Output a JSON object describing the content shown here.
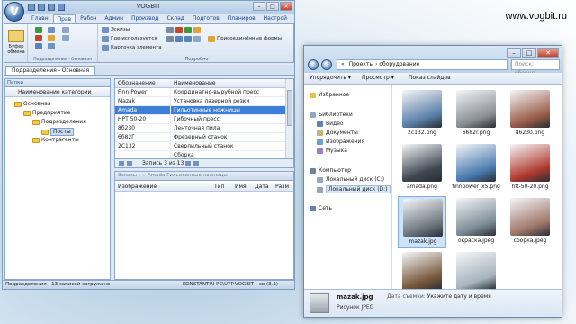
{
  "website": "www.vogbit.ru",
  "app": {
    "title": "VOGBIT",
    "tabs": [
      "Главн",
      "Прав",
      "Рабоч",
      "Админ",
      "Производ",
      "Склад",
      "Подготов",
      "Планиров",
      "Настрой"
    ],
    "active_tab": "Прав",
    "ribbon": {
      "buffer_label": "Буфер обмена",
      "group1_label": "Подразделения - Основная",
      "items": [
        "Эскизы",
        "Где используется",
        "Карточка элемента"
      ],
      "right_item": "Присоединённые формы",
      "group2_label": "Подробно"
    },
    "doc_tab": "Подразделения - Основная",
    "tree": {
      "panel_title": "Папки",
      "column": "Наименование категории",
      "items": [
        "Основная",
        "Предприятие",
        "Подразделения",
        "Посты",
        "Контрагенты"
      ]
    },
    "grid": {
      "columns": [
        "Обозначение",
        "Наименование"
      ],
      "rows": [
        [
          "Finn Power",
          "Координатно-вырубной пресс"
        ],
        [
          "Mazak",
          "Установка лазерной резки"
        ],
        [
          "Amada",
          "Гильотинные ножницы"
        ],
        [
          "HPT 50-20",
          "Гибочный пресс"
        ],
        [
          "8б230",
          "Ленточная пила"
        ],
        [
          "6б82Г",
          "Фрезерный станок"
        ],
        [
          "2С132",
          "Сверлильный станок"
        ],
        [
          "",
          "Сборка"
        ]
      ],
      "selected_row": 2,
      "record_status": "Запись 3 из 13"
    },
    "detail": {
      "header": "Эскизы » » Amada Гильотинные ножницы",
      "columns": [
        "Изображение",
        "Тип",
        "Имя",
        "Дата",
        "Разм"
      ]
    },
    "status": {
      "left": "Подразделения - 13 записей загружено",
      "user": "KONSTANTIN-PC\\UTP",
      "db": "VOGBIT",
      "ver": "эв (3.1)"
    }
  },
  "explorer": {
    "address": "« _Проекты › оборудование",
    "search_placeholder": "Поиск: оборуд...",
    "toolbar": [
      "Упорядочить ▾",
      "Просмотр ▾",
      "Показ слайдов"
    ],
    "nav": {
      "favorites": "Избранное",
      "libraries": "Библиотеки",
      "library_items": [
        "Видео",
        "Документы",
        "Изображения",
        "Музыка"
      ],
      "computer": "Компьютер",
      "drives": [
        "Локальный диск (C:)",
        "Локальный диск (D:)"
      ],
      "network": "Сеть"
    },
    "files": [
      {
        "name": "2c132.png",
        "color": "#5b7fa8"
      },
      {
        "name": "6682r.png",
        "color": "#8a8f96"
      },
      {
        "name": "86230.png",
        "color": "#9a5d4a"
      },
      {
        "name": "amada.png",
        "color": "#3e4650"
      },
      {
        "name": "finnpower_x5.png",
        "color": "#4a7bb0"
      },
      {
        "name": "hft-50-20.png",
        "color": "#b03a2e"
      },
      {
        "name": "mazak.jpg",
        "color": "#6e7780"
      },
      {
        "name": "окраска.jpeg",
        "color": "#7c8c96"
      },
      {
        "name": "сборка.jpeg",
        "color": "#a0786a"
      },
      {
        "name": "",
        "color": "#7a5a3c"
      },
      {
        "name": "",
        "color": "#a7b3bd"
      }
    ],
    "selected_file": 6,
    "details": {
      "name": "mazak.jpg",
      "type": "Рисунок JPEG",
      "date_label": "Дата съемки:",
      "date_value": "Укажите дату и время"
    }
  }
}
